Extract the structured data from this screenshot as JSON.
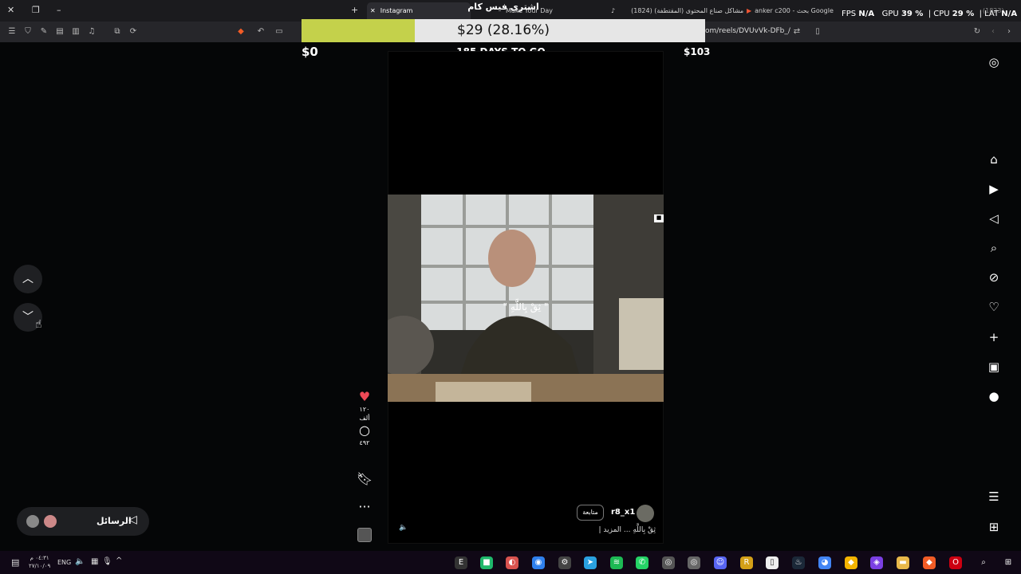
{
  "browser": {
    "tabs": [
      {
        "title": "Instagram"
      },
      {
        "title": "Make Your Day"
      },
      {
        "title": "(1824) مشاكل صناع المحتوى (المقتطفة)"
      },
      {
        "title": "anker c200 - بحث Google"
      },
      {
        "title": "(1823) "
      }
    ],
    "url": "om/reels/DVUvVk-DFb_/"
  },
  "overlay": {
    "banner": "اشترى فيس كام",
    "progress_text": "$29 (28.16%)",
    "progress_fraction": 0.2816,
    "start_amount": "$0",
    "goal_amount": "$103",
    "days": "185 DAYS TO GO",
    "accent_color": "#c4d14b"
  },
  "stats": {
    "fps_label": "FPS",
    "fps_value": "N/A",
    "gpu_label": "GPU",
    "gpu_value": "39 %",
    "cpu_label": "CPU",
    "cpu_value": "29 %",
    "lat_label": "LAT",
    "lat_value": "N/A"
  },
  "reel": {
    "caption_overlay": "\" ثِقْ بِاللَّهِ \"",
    "username": "r8_x1",
    "follow_label": "متابعة",
    "description": "| ثِقْ بِاللَّهِ ... المزيد",
    "likes": "١٢٠ ألف",
    "comments": "٤٩٢"
  },
  "messages": {
    "label": "الرسائل"
  },
  "taskbar": {
    "lang": "ENG",
    "time": "٠٤:٣١ م",
    "date": "٢٧/١٠/٠٩"
  },
  "icons": {
    "heart_color": "#ed4956",
    "sidebar": [
      "instagram-icon",
      "home-icon",
      "reels-icon",
      "messages-icon",
      "search-icon",
      "explore-icon",
      "notifications-icon",
      "create-icon",
      "dashboard-icon",
      "profile-icon",
      "menu-icon",
      "more-apps-icon"
    ]
  }
}
